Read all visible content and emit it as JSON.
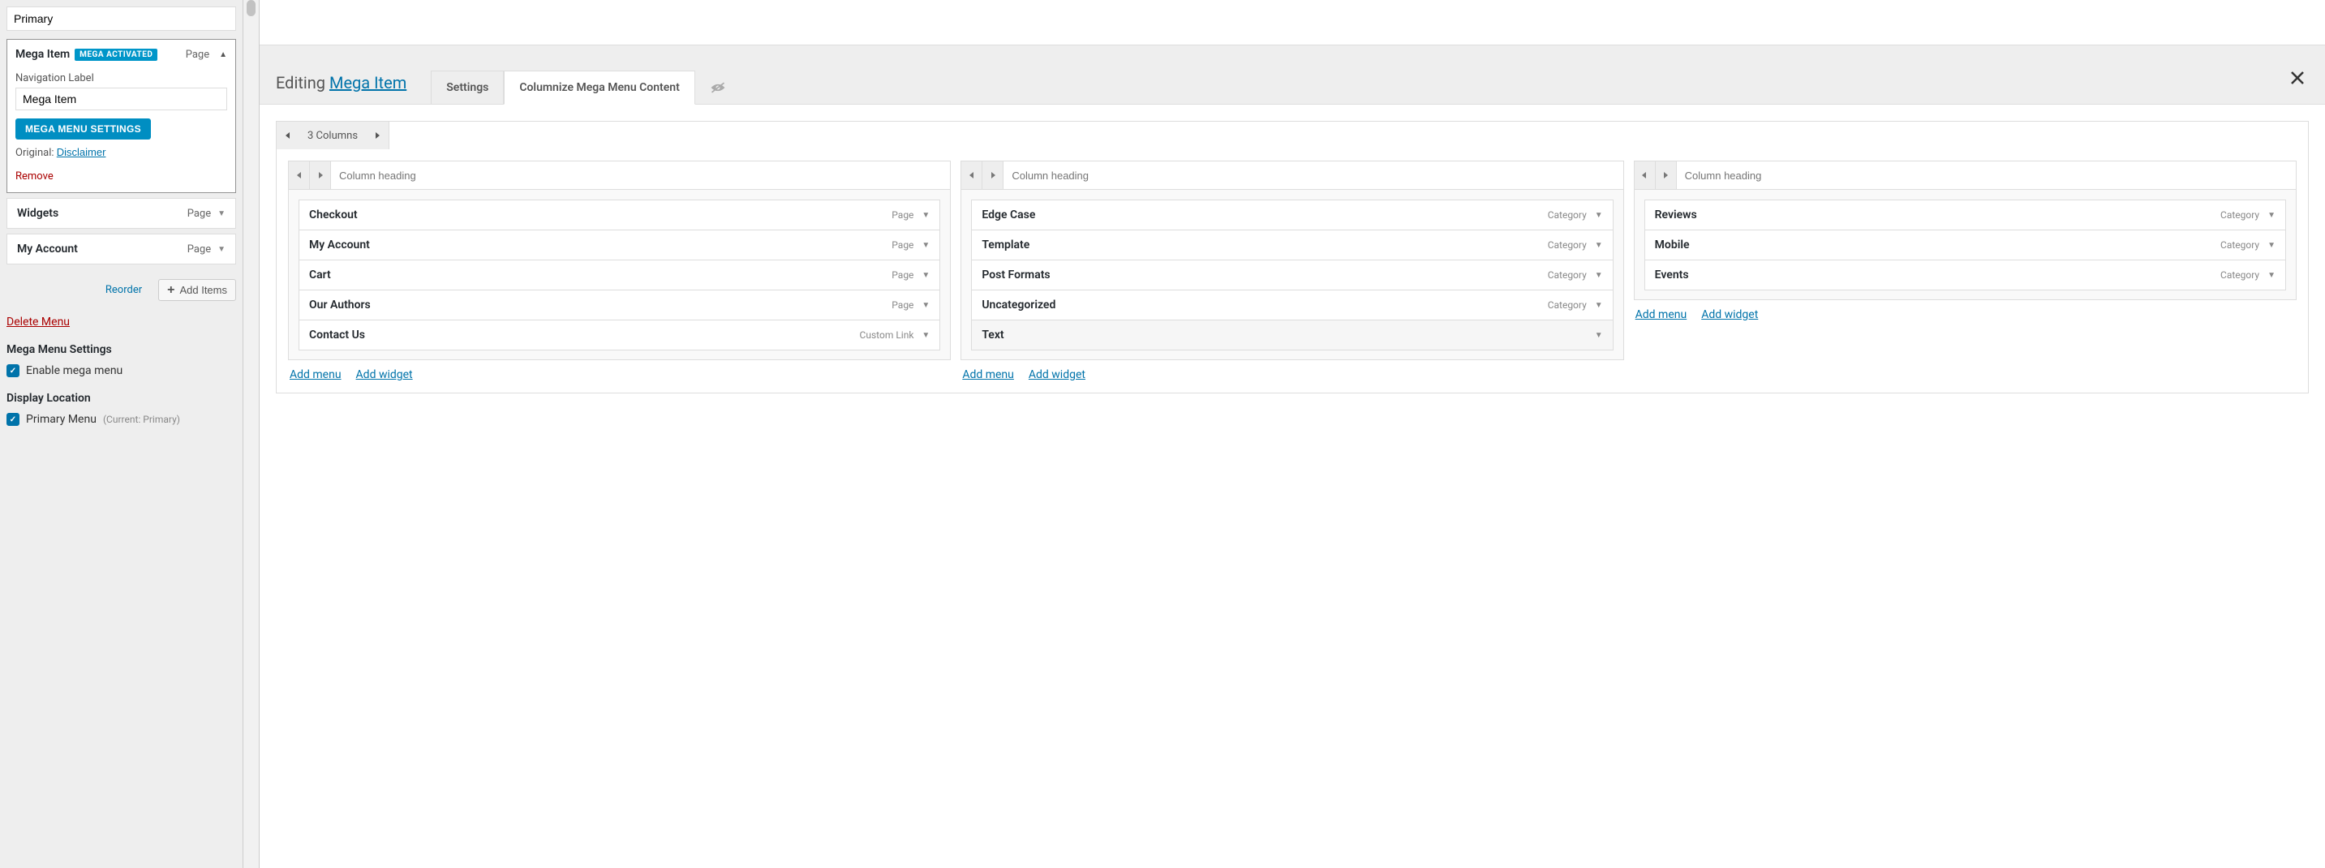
{
  "sidebar": {
    "menu_name": "Primary",
    "item": {
      "title": "Mega Item",
      "badge": "MEGA ACTIVATED",
      "type": "Page",
      "nav_label_caption": "Navigation Label",
      "nav_label_value": "Mega Item",
      "settings_btn": "MEGA MENU SETTINGS",
      "original_caption": "Original:",
      "original_link": "Disclaimer",
      "remove": "Remove"
    },
    "collapsed": [
      {
        "title": "Widgets",
        "type": "Page"
      },
      {
        "title": "My Account",
        "type": "Page"
      }
    ],
    "reorder": "Reorder",
    "add_items": "Add Items",
    "delete_menu": "Delete Menu",
    "mega_settings_title": "Mega Menu Settings",
    "enable_mega": "Enable mega menu",
    "display_location_title": "Display Location",
    "display_location_label": "Primary Menu",
    "display_location_note": "(Current: Primary)"
  },
  "toolbar": {
    "editing": "Editing",
    "editing_target": "Mega Item",
    "tab_settings": "Settings",
    "tab_columnize": "Columnize Mega Menu Content"
  },
  "cols_control": {
    "label": "3 Columns"
  },
  "col_heading_placeholder": "Column heading",
  "columns": [
    {
      "rows": [
        {
          "title": "Checkout",
          "type": "Page"
        },
        {
          "title": "My Account",
          "type": "Page"
        },
        {
          "title": "Cart",
          "type": "Page"
        },
        {
          "title": "Our Authors",
          "type": "Page"
        },
        {
          "title": "Contact Us",
          "type": "Custom Link"
        }
      ]
    },
    {
      "rows": [
        {
          "title": "Edge Case",
          "type": "Category"
        },
        {
          "title": "Template",
          "type": "Category"
        },
        {
          "title": "Post Formats",
          "type": "Category"
        },
        {
          "title": "Uncategorized",
          "type": "Category"
        },
        {
          "title": "Text",
          "type": ""
        }
      ]
    },
    {
      "rows": [
        {
          "title": "Reviews",
          "type": "Category"
        },
        {
          "title": "Mobile",
          "type": "Category"
        },
        {
          "title": "Events",
          "type": "Category"
        }
      ]
    }
  ],
  "links": {
    "add_menu": "Add menu",
    "add_widget": "Add widget"
  }
}
